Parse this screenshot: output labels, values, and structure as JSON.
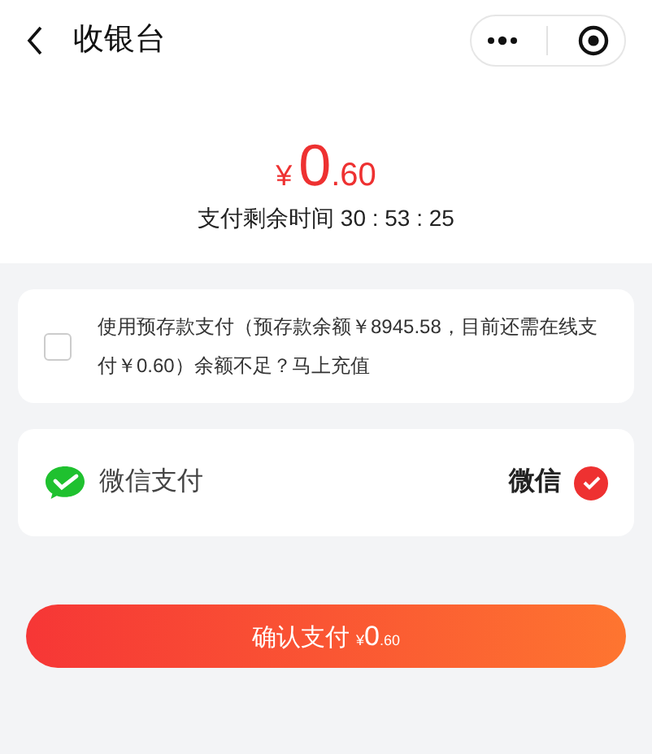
{
  "nav": {
    "title": "收银台"
  },
  "amount": {
    "currency": "¥",
    "integer": "0",
    "decimals": ".60"
  },
  "countdown": {
    "label": "支付剩余时间",
    "time": "30 : 53 : 25"
  },
  "balance_option": {
    "checked": false,
    "text": "使用预存款支付（预存款余额￥8945.58，目前还需在线支付￥0.60）余额不足？马上充值"
  },
  "payment_methods": [
    {
      "name": "微信支付",
      "tag": "微信",
      "selected": true
    }
  ],
  "confirm_button": {
    "label": "确认支付",
    "currency": "¥",
    "integer": "0",
    "decimals": ".60"
  }
}
